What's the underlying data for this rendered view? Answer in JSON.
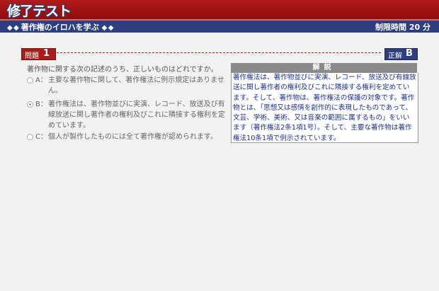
{
  "header": {
    "title": "修了テスト"
  },
  "subbar": {
    "left_icon": "◆ ◆",
    "left_icon_right": "◆ ◆",
    "course": "著作権のイロハを学ぶ",
    "time_limit": "制限時間 20 分"
  },
  "question": {
    "label": "問題",
    "number": "1",
    "answer_label": "正解",
    "answer_value": "B",
    "text": "著作物に関する次の記述のうち、正しいものはどれですか。",
    "choices": [
      {
        "letter": "A：",
        "text": "主要な著作物に関して、著作権法に例示規定はありません。",
        "selected": false
      },
      {
        "letter": "B：",
        "text": "著作権法は、著作物並びに実演、レコード、放送及び有線放送に関し著作者の権利及びこれに隣接する権利を定めています。",
        "selected": true
      },
      {
        "letter": "C：",
        "text": "個人が製作したものには全て著作権が認められます。",
        "selected": false
      }
    ]
  },
  "explanation": {
    "heading": "解説",
    "text": "著作権法は、著作物並びに実演、レコード、放送及び有線放送に関し著作者の権利及びこれに隣接する権利を定めています。そして、著作物は、著作権法の保護の対象です。著作物とは、「思想又は感情を創作的に表現したものであって、文芸、学術、美術、又は音楽の範囲に属するもの」をいいます（著作権法2条1項1号）。そして、主要な著作物は著作権法10条1項で例示されています。"
  }
}
